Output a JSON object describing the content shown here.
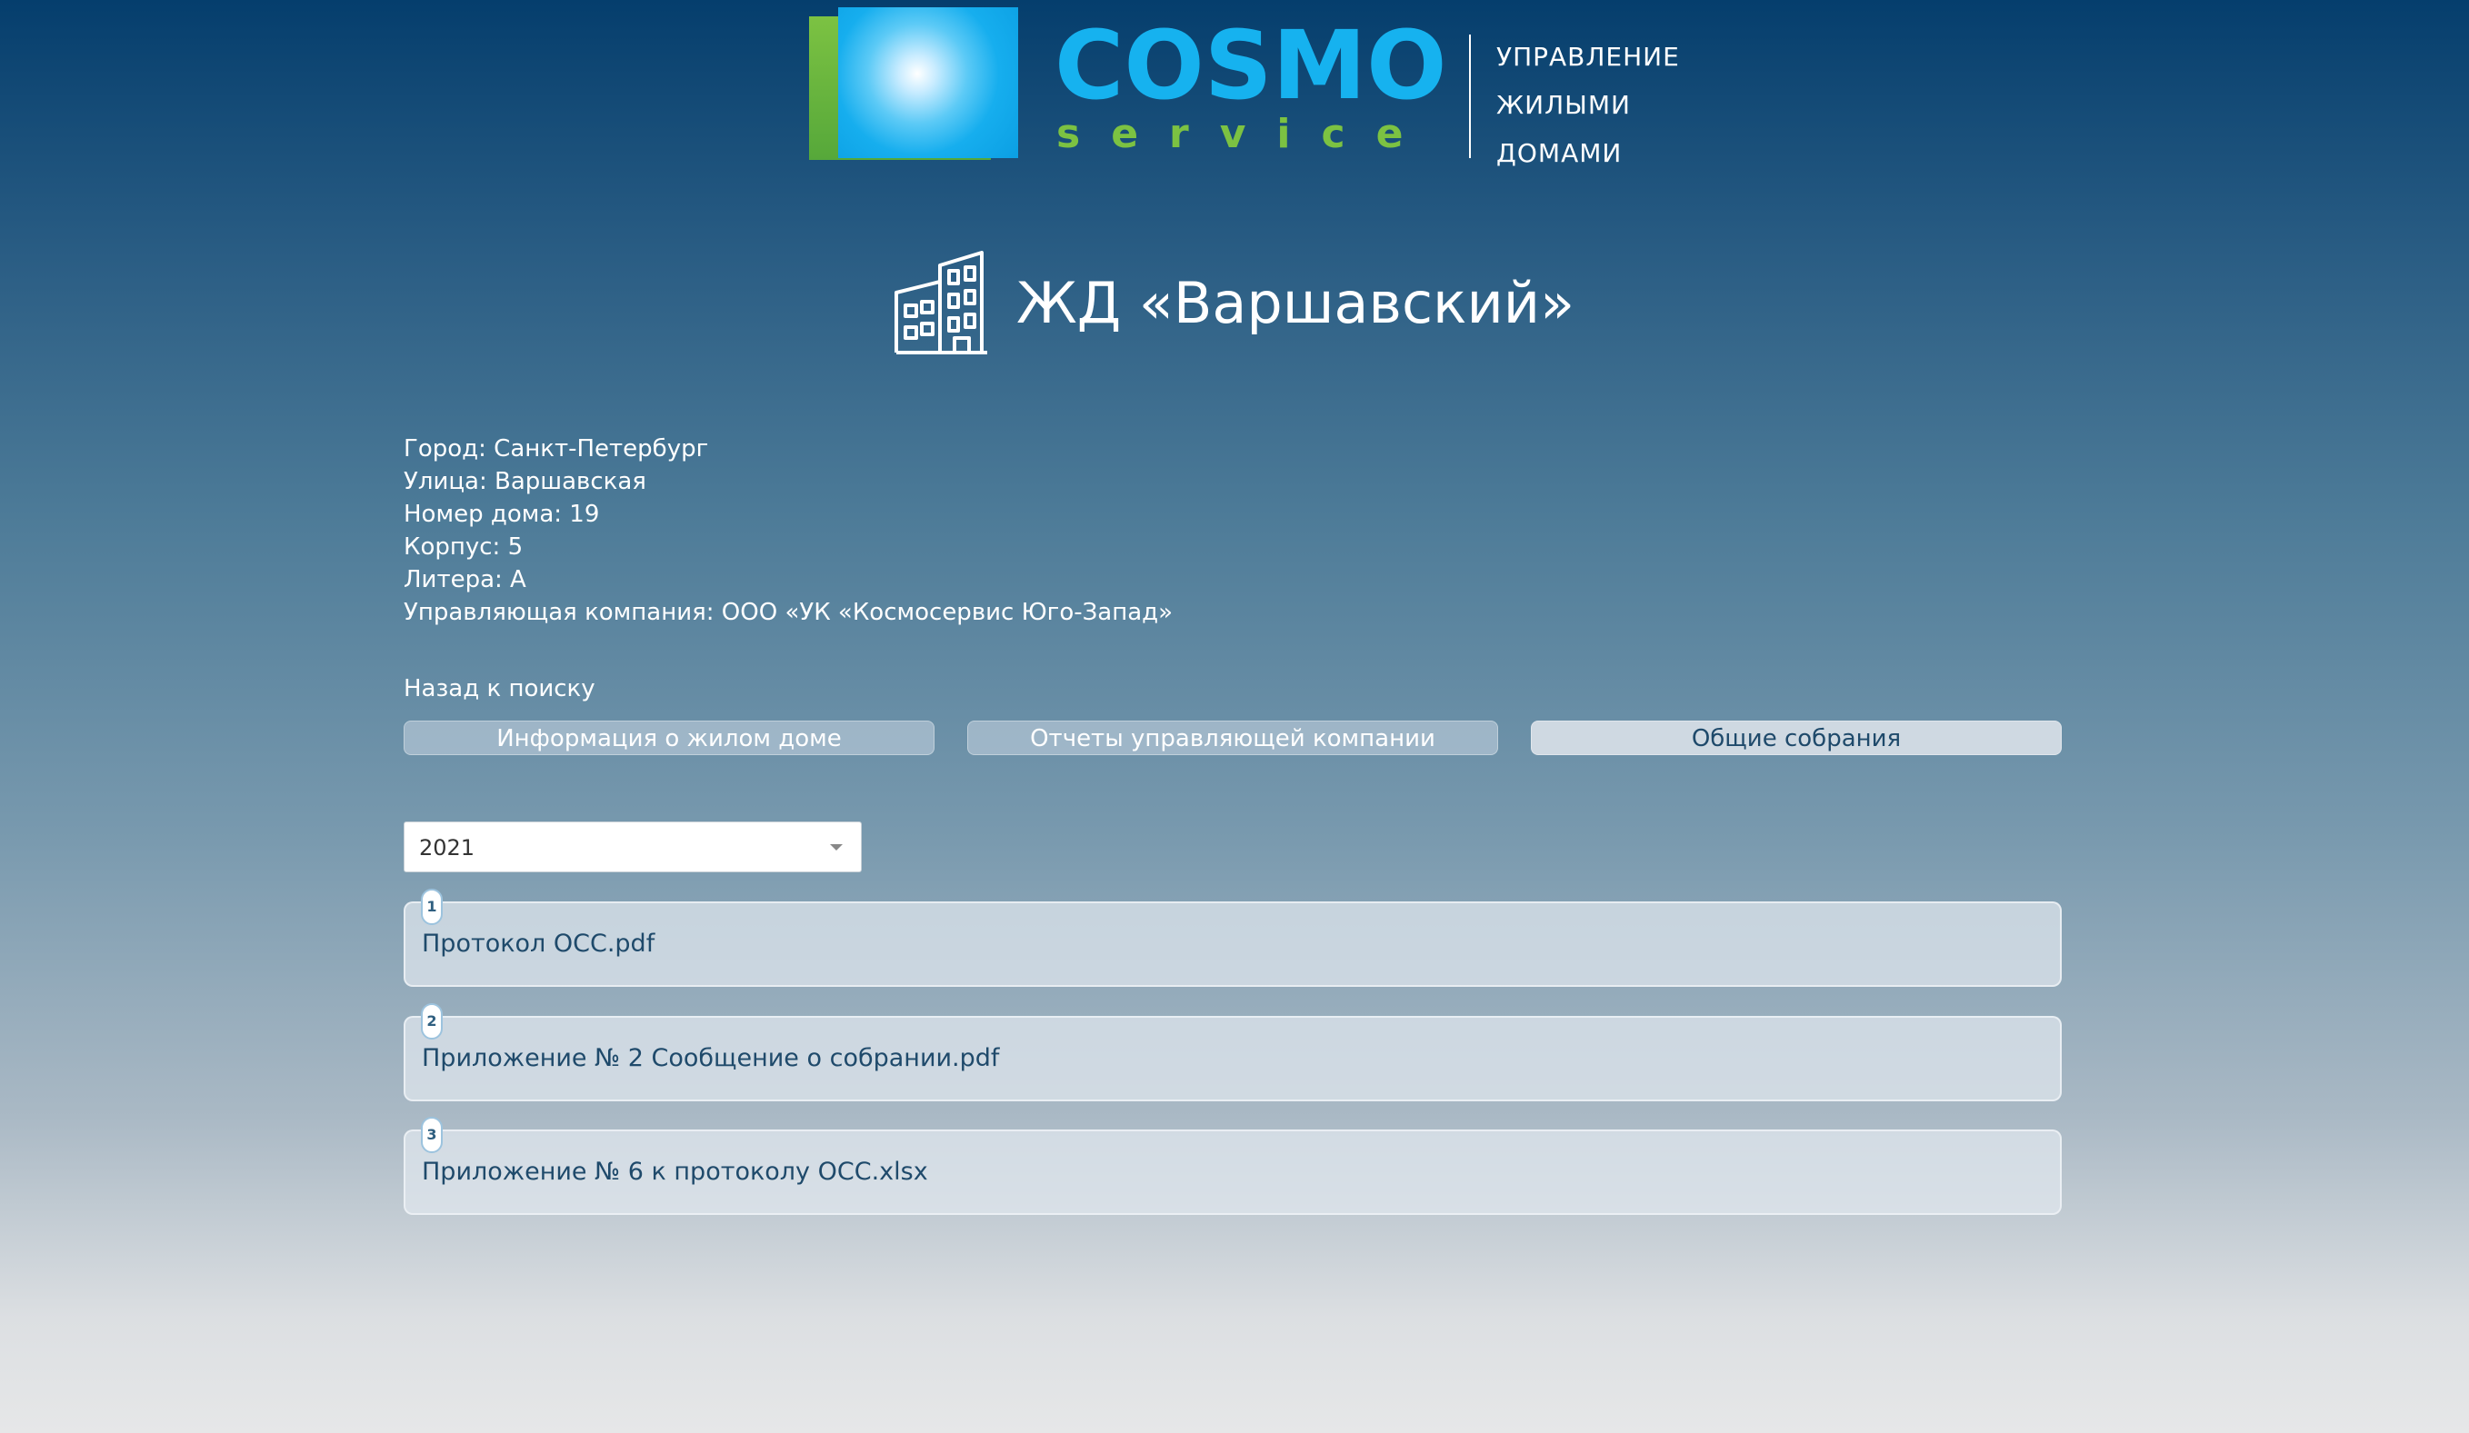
{
  "header": {
    "brand_main": "COSMO",
    "brand_sub": "service",
    "tagline": [
      "УПРАВЛЕНИЕ",
      "ЖИЛЫМИ",
      "ДОМАМИ"
    ]
  },
  "page": {
    "title": "ЖД «Варшавский»",
    "title_icon": "building-icon"
  },
  "info": {
    "city": "Город: Санкт-Петербург",
    "street": "Улица: Варшавская",
    "house": "Номер дома: 19",
    "building": "Корпус: 5",
    "letter": "Литера: А",
    "company": "Управляющая компания: ООО «УК «Космосервис Юго-Запад»"
  },
  "nav": {
    "back_label": "Назад к поиску"
  },
  "tabs": [
    {
      "label": "Информация о жилом доме",
      "active": false
    },
    {
      "label": "Отчеты управляющей компании",
      "active": false
    },
    {
      "label": "Общие собрания",
      "active": true
    }
  ],
  "year_select": {
    "value": "2021"
  },
  "documents": [
    {
      "index": "1",
      "name": "Протокол ОСС.pdf"
    },
    {
      "index": "2",
      "name": "Приложение № 2 Сообщение о собрании.pdf"
    },
    {
      "index": "3",
      "name": "Приложение № 6 к протоколу ОСС.xlsx"
    }
  ],
  "colors": {
    "brand_blue": "#16b2ef",
    "brand_green": "#7cc242",
    "text_dark": "#1f4a6b"
  }
}
